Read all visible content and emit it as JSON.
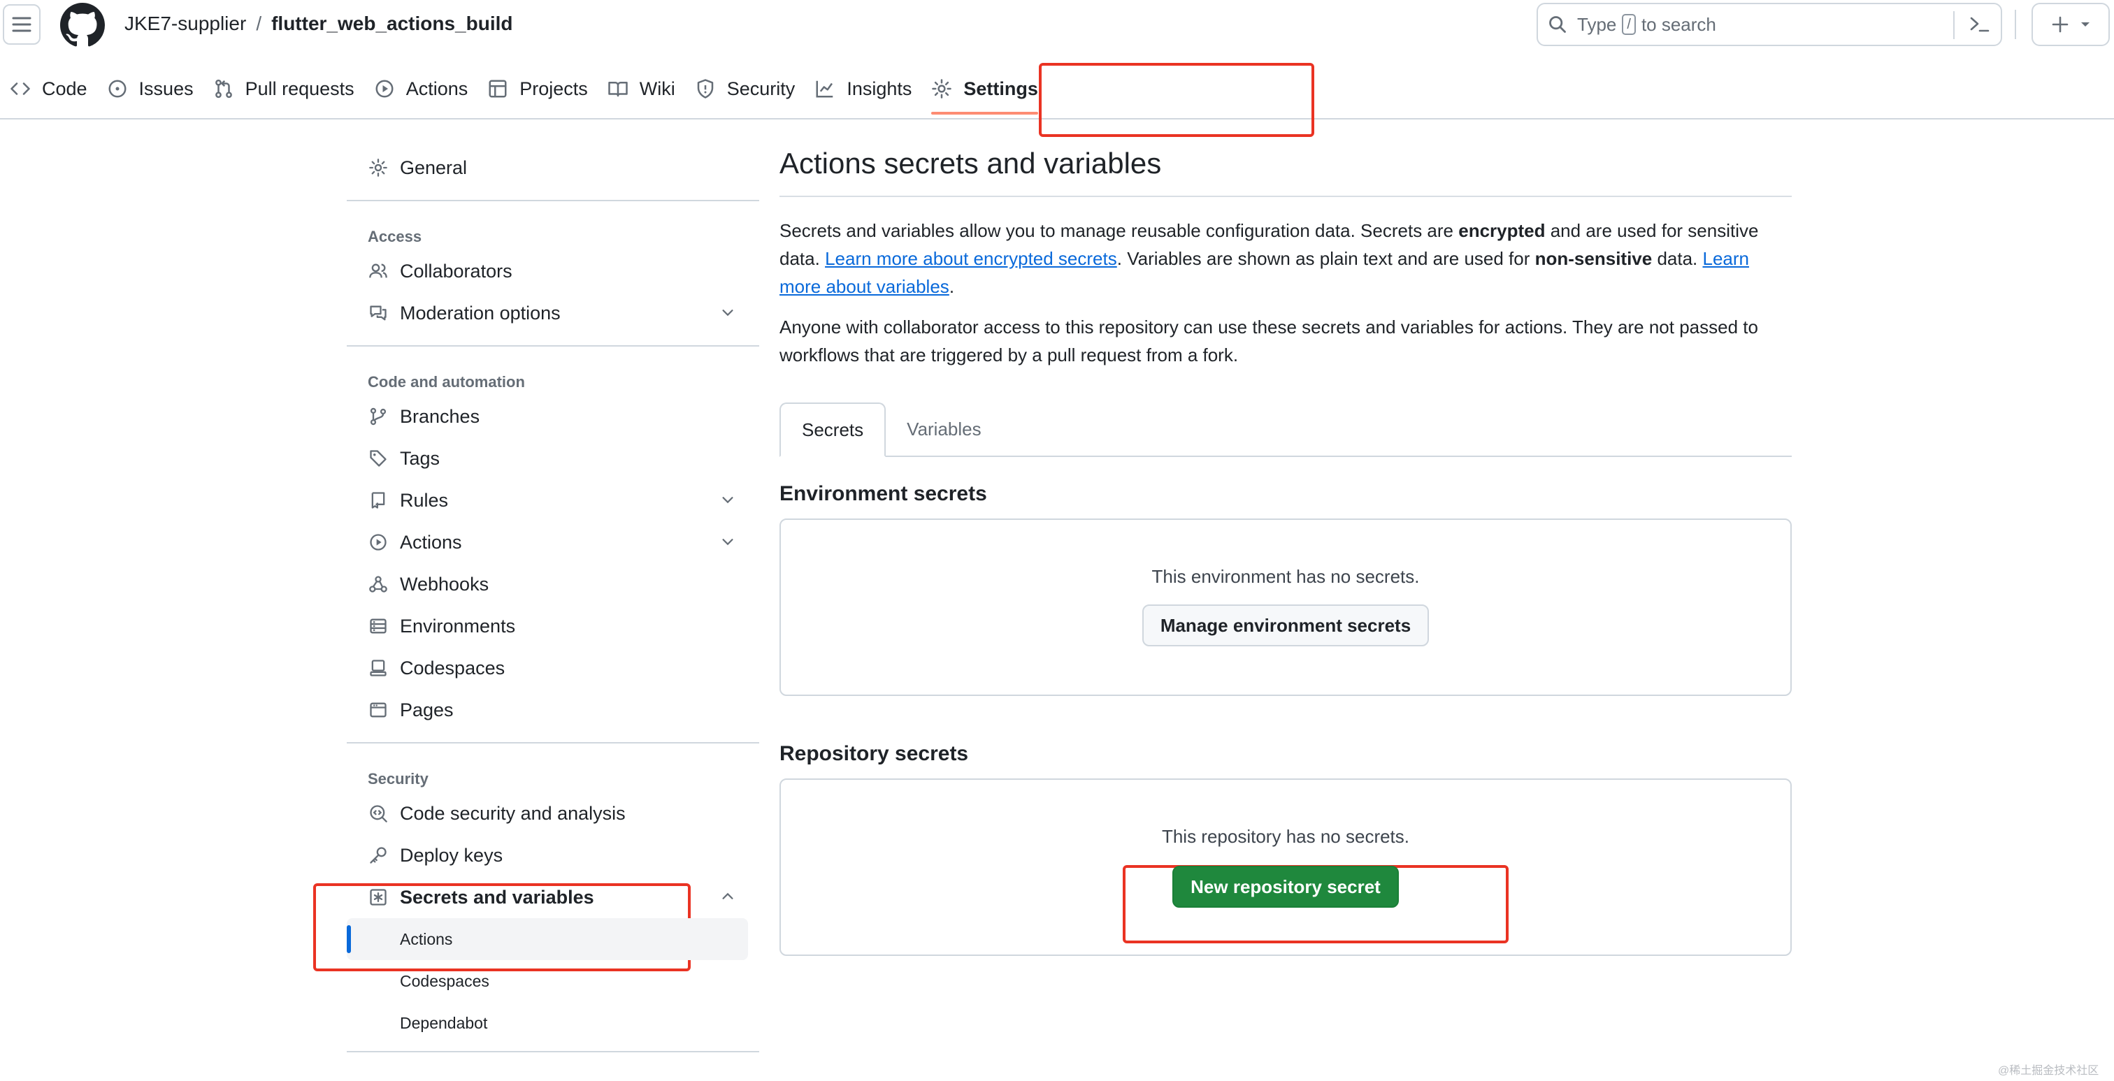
{
  "header": {
    "owner": "JKE7-supplier",
    "separator": "/",
    "repo": "flutter_web_actions_build",
    "search": {
      "prefix": "Type",
      "key": "/",
      "suffix": "to search"
    }
  },
  "tabs": [
    {
      "label": "Code",
      "icon": "code-icon"
    },
    {
      "label": "Issues",
      "icon": "issue-opened-icon"
    },
    {
      "label": "Pull requests",
      "icon": "git-pull-request-icon"
    },
    {
      "label": "Actions",
      "icon": "play-icon"
    },
    {
      "label": "Projects",
      "icon": "table-icon"
    },
    {
      "label": "Wiki",
      "icon": "book-icon"
    },
    {
      "label": "Security",
      "icon": "shield-icon"
    },
    {
      "label": "Insights",
      "icon": "graph-icon"
    },
    {
      "label": "Settings",
      "icon": "gear-icon",
      "active": true
    }
  ],
  "sidebar": {
    "general": "General",
    "access_heading": "Access",
    "collaborators": "Collaborators",
    "moderation": "Moderation options",
    "code_heading": "Code and automation",
    "branches": "Branches",
    "tags": "Tags",
    "rules": "Rules",
    "actions": "Actions",
    "webhooks": "Webhooks",
    "environments": "Environments",
    "codespaces": "Codespaces",
    "pages": "Pages",
    "security_heading": "Security",
    "code_security": "Code security and analysis",
    "deploy_keys": "Deploy keys",
    "secrets": "Secrets and variables",
    "sub_actions": "Actions",
    "sub_codespaces": "Codespaces",
    "sub_dependabot": "Dependabot"
  },
  "main": {
    "title": "Actions secrets and variables",
    "p1": {
      "t1": "Secrets and variables allow you to manage reusable configuration data. Secrets are ",
      "b1": "encrypted",
      "t2": " and are used for sensitive data. ",
      "link1": "Learn more about encrypted secrets",
      "t3": ". Variables are shown as plain text and are used for ",
      "b2": "non-sensitive",
      "t4": " data. ",
      "link2": "Learn more about variables",
      "t5": "."
    },
    "p2": "Anyone with collaborator access to this repository can use these secrets and variables for actions. They are not passed to workflows that are triggered by a pull request from a fork.",
    "subtabs": {
      "secrets": "Secrets",
      "variables": "Variables"
    },
    "env_title": "Environment secrets",
    "env_empty": "This environment has no secrets.",
    "env_button": "Manage environment secrets",
    "repo_title": "Repository secrets",
    "repo_empty": "This repository has no secrets.",
    "repo_button": "New repository secret"
  },
  "watermark": "@稀土掘金技术社区",
  "colors": {
    "primary_button": "#1f883d",
    "link": "#0969da",
    "annotation_box": "#ea3323",
    "active_tab_underline": "#fd8c73"
  }
}
